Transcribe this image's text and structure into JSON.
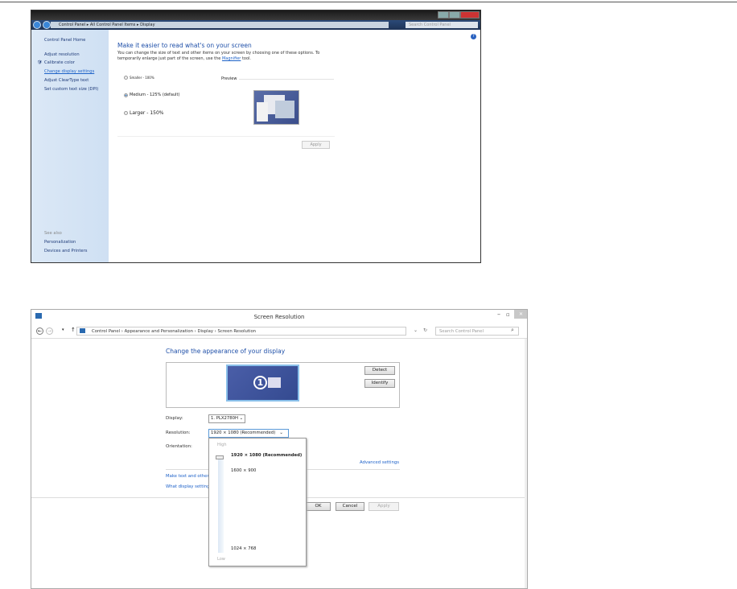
{
  "win7": {
    "breadcrumb": [
      "Control Panel",
      "All Control Panel Items",
      "Display"
    ],
    "search_placeholder": "Search Control Panel",
    "sidebar": {
      "home": "Control Panel Home",
      "items": [
        "Adjust resolution",
        "Calibrate color",
        "Change display settings",
        "Adjust ClearType text",
        "Set custom text size (DPI)"
      ],
      "see_also": "See also",
      "see_also_items": [
        "Personalization",
        "Devices and Printers"
      ]
    },
    "heading": "Make it easier to read what's on your screen",
    "desc_before": "You can change the size of text and other items on your screen by choosing one of these options. To temporarily enlarge just part of the screen, use the ",
    "desc_link": "Magnifier",
    "desc_after": " tool.",
    "options": [
      "Smaller - 100%",
      "Medium - 125% (default)",
      "Larger - 150%"
    ],
    "selected_option": "Medium - 125% (default)",
    "preview_label": "Preview",
    "apply": "Apply"
  },
  "win8": {
    "title": "Screen Resolution",
    "breadcrumb": [
      "Control Panel",
      "Appearance and Personalization",
      "Display",
      "Screen Resolution"
    ],
    "search_placeholder": "Search Control Panel",
    "heading": "Change the appearance of your display",
    "monitor_number": "1",
    "detect": "Detect",
    "identify": "Identify",
    "display_label": "Display:",
    "display_value": "1. PLX2780H",
    "resolution_label": "Resolution:",
    "resolution_value": "1920 × 1080 (Recommended)",
    "orientation_label": "Orientation:",
    "advanced": "Advanced settings",
    "link1": "Make text and other",
    "link2": "What display setting",
    "ok": "OK",
    "cancel": "Cancel",
    "apply": "Apply",
    "dropdown": {
      "high": "High",
      "low": "Low",
      "options": [
        "1920 × 1080 (Recommended)",
        "1600 × 900",
        "1024 × 768"
      ],
      "selected": "1920 × 1080 (Recommended)"
    }
  }
}
